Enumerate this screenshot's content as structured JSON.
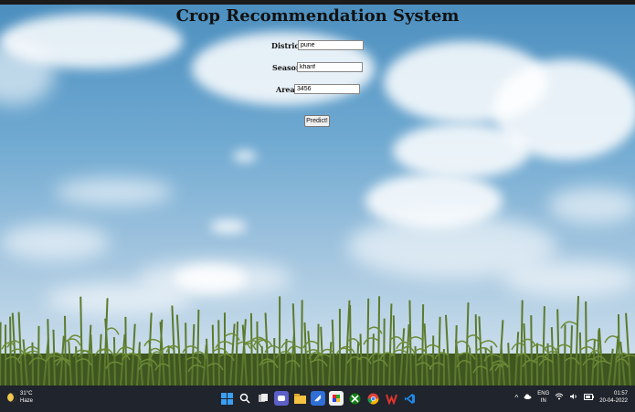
{
  "page": {
    "title": "Crop Recommendation System"
  },
  "form": {
    "district_label": "District :",
    "district_value": "pune",
    "season_label": "Season :",
    "season_value": "kharif",
    "area_label": "Area :",
    "area_value": "3456",
    "predict_label": "Predict!"
  },
  "taskbar": {
    "weather_temp": "31°C",
    "weather_desc": "Haze",
    "lang_line1": "ENG",
    "lang_line2": "IN",
    "time": "01:57",
    "date": "20-04-2022",
    "icons": [
      "windows-start-icon",
      "search-icon",
      "task-view-icon",
      "chat-icon",
      "file-explorer-icon",
      "store-icon",
      "app-icon",
      "xbox-icon",
      "chrome-icon",
      "wps-icon",
      "vscode-icon"
    ]
  },
  "colors": {
    "sky": "#6fa9d1",
    "taskbar": "#20242c",
    "crop_green": "#4f6b2a"
  }
}
